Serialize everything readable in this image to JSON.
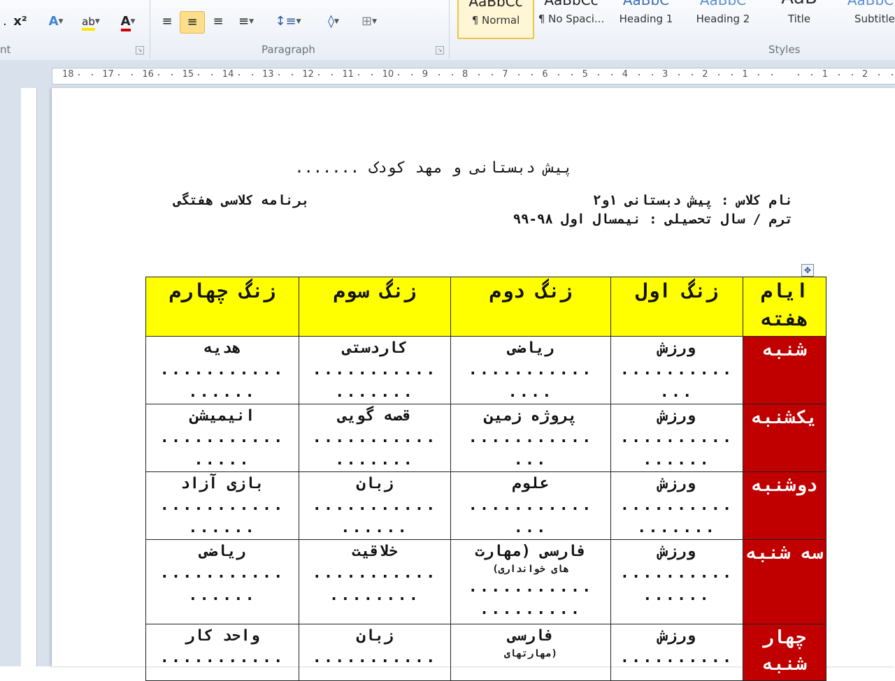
{
  "ribbon": {
    "font_group_label": "nt",
    "paragraph_group_label": "Paragraph",
    "styles_group_label": "Styles",
    "styles": [
      {
        "name": "¶ Normal",
        "selected": true
      },
      {
        "name": "¶ No Spaci...",
        "selected": false
      },
      {
        "name": "Heading 1",
        "selected": false
      },
      {
        "name": "Heading 2",
        "selected": false
      },
      {
        "name": "Title",
        "selected": false
      },
      {
        "name": "Subtitle",
        "selected": false
      }
    ],
    "icons": [
      "superscript-icon",
      "text-effects-icon",
      "highlight-icon",
      "font-color-icon",
      "align-left-icon",
      "align-center-icon",
      "align-right-icon",
      "justify-icon",
      "line-spacing-icon",
      "shading-icon",
      "borders-icon"
    ]
  },
  "ruler": {
    "numbers": [
      "18",
      "17",
      "16",
      "15",
      "14",
      "13",
      "12",
      "11",
      "10",
      "9",
      "8",
      "7",
      "6",
      "5",
      "4",
      "3",
      "2",
      "1",
      "",
      "1",
      "2"
    ]
  },
  "document": {
    "title": "پیش دبستانی و مهد کودک .......",
    "class_name": "نام کلاس : پیش دبستانی ۱و۲",
    "program": "برنامه کلاسی هفتگی",
    "term": "ترم / سال تحصیلی : نیمسال اول ۹۸-۹۹"
  },
  "table": {
    "headers": [
      "ایام هفته",
      "زنگ اول",
      "زنگ دوم",
      "زنگ سوم",
      "زنگ چهارم"
    ],
    "rows": [
      {
        "day": "شنبه",
        "cells": [
          {
            "main": "ورزش",
            "dots1": "..........",
            "dots2": "..."
          },
          {
            "main": "ریاضی",
            "dots1": "...........",
            "dots2": "...."
          },
          {
            "main": "کاردستی",
            "dots1": "...........",
            "dots2": "......."
          },
          {
            "main": "هدیه",
            "dots1": "...........",
            "dots2": "......"
          }
        ]
      },
      {
        "day": "یکشنبه",
        "cells": [
          {
            "main": "ورزش",
            "dots1": "..........",
            "dots2": "......"
          },
          {
            "main": "پروژه زمین",
            "dots1": "...........",
            "dots2": "..."
          },
          {
            "main": "قصه گویی",
            "dots1": "...........",
            "dots2": "......."
          },
          {
            "main": "انیمیشن",
            "dots1": "...........",
            "dots2": "....."
          }
        ]
      },
      {
        "day": "دوشنبه",
        "cells": [
          {
            "main": "ورزش",
            "dots1": "..........",
            "dots2": "......."
          },
          {
            "main": "علوم",
            "dots1": "...........",
            "dots2": "..."
          },
          {
            "main": "زبان",
            "dots1": "...........",
            "dots2": "......"
          },
          {
            "main": "بازی آزاد",
            "dots1": "...........",
            "dots2": "......"
          }
        ]
      },
      {
        "day": "سه شنبه",
        "cells": [
          {
            "main": "ورزش",
            "dots1": "..........",
            "dots2": "......"
          },
          {
            "main": "فارسی (مهارت",
            "sub": "های خوانداری)",
            "dots1": "...........",
            "dots2": "........."
          },
          {
            "main": "خلاقیت",
            "dots1": "...........",
            "dots2": "........"
          },
          {
            "main": "ریاضی",
            "dots1": "...........",
            "dots2": "......"
          }
        ]
      },
      {
        "day": "چهار شنبه",
        "cells": [
          {
            "main": "ورزش",
            "dots1": "..........",
            "dots2": ""
          },
          {
            "main": "فارسی",
            "sub": "(مهارتهای",
            "dots1": "",
            "dots2": ""
          },
          {
            "main": "زبان",
            "dots1": "...........",
            "dots2": ""
          },
          {
            "main": "واحد کار",
            "dots1": "...........",
            "dots2": ""
          }
        ]
      }
    ]
  },
  "colors": {
    "header_fill": "#ffff00",
    "day_fill": "#c00000",
    "day_text": "#ffffff",
    "selected_style": "#fbdf8a"
  }
}
